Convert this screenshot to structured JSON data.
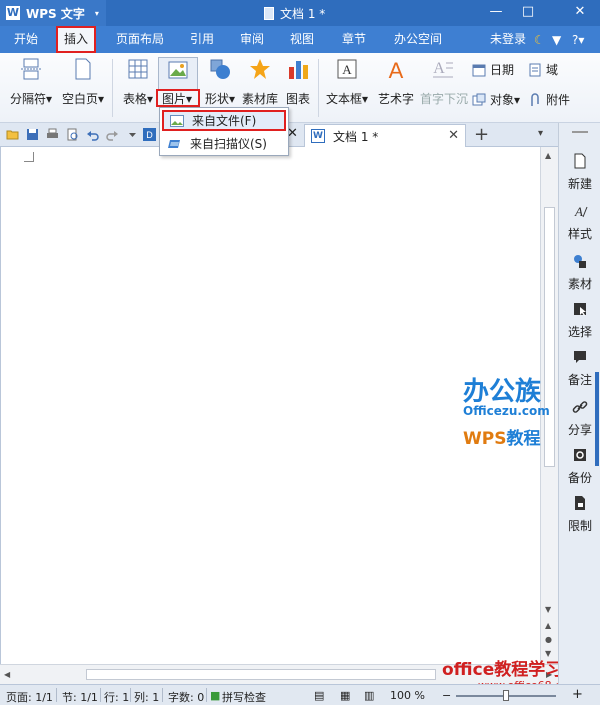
{
  "titlebar": {
    "app_name": "WPS 文字",
    "app_caret": "▾",
    "doc_title": "文档 1 *",
    "minimize": "—",
    "maximize": "□",
    "close": "✕"
  },
  "menu": {
    "tabs": [
      "开始",
      "插入",
      "页面布局",
      "引用",
      "审阅",
      "视图",
      "章节",
      "办公空间"
    ],
    "active_tab": "插入",
    "login": "未登录",
    "help": "?▾"
  },
  "ribbon": {
    "buttons": {
      "page_break": "分隔符▾",
      "blank_page": "空白页▾",
      "table": "表格▾",
      "picture": "图片▾",
      "shape": "形状▾",
      "material": "素材库",
      "chart": "图表",
      "textbox": "文本框▾",
      "wordart": "艺术字",
      "dropcap": "首字下沉",
      "date": "日期",
      "field": "域",
      "object": "对象▾",
      "attachment": "附件"
    }
  },
  "picture_dropdown": {
    "items": [
      "来自文件(F)",
      "来自扫描仪(S)"
    ]
  },
  "doc_tabs": {
    "tab_label": "文档 1 *",
    "close": "✕",
    "add": "+"
  },
  "sidebar": {
    "items": [
      "新建",
      "样式",
      "素材",
      "选择",
      "备注",
      "分享",
      "备份",
      "限制"
    ]
  },
  "watermark": {
    "brand_cn": "办公族",
    "brand_url": "Officezu.com",
    "wps_text": "WPS",
    "tutorial_text": "教程",
    "site_cn": "office教程学习网",
    "site_url": "www.office68.com"
  },
  "status": {
    "page": "页面: 1/1",
    "section": "节: 1/1",
    "line": "行: 1",
    "column": "列: 1",
    "words": "字数: 0",
    "spellcheck": "拼写检查",
    "zoom": "100 %",
    "zoom_level": 0.5
  },
  "colors": {
    "title_blue": "#2f6dbd",
    "highlight_red": "#e02020"
  }
}
